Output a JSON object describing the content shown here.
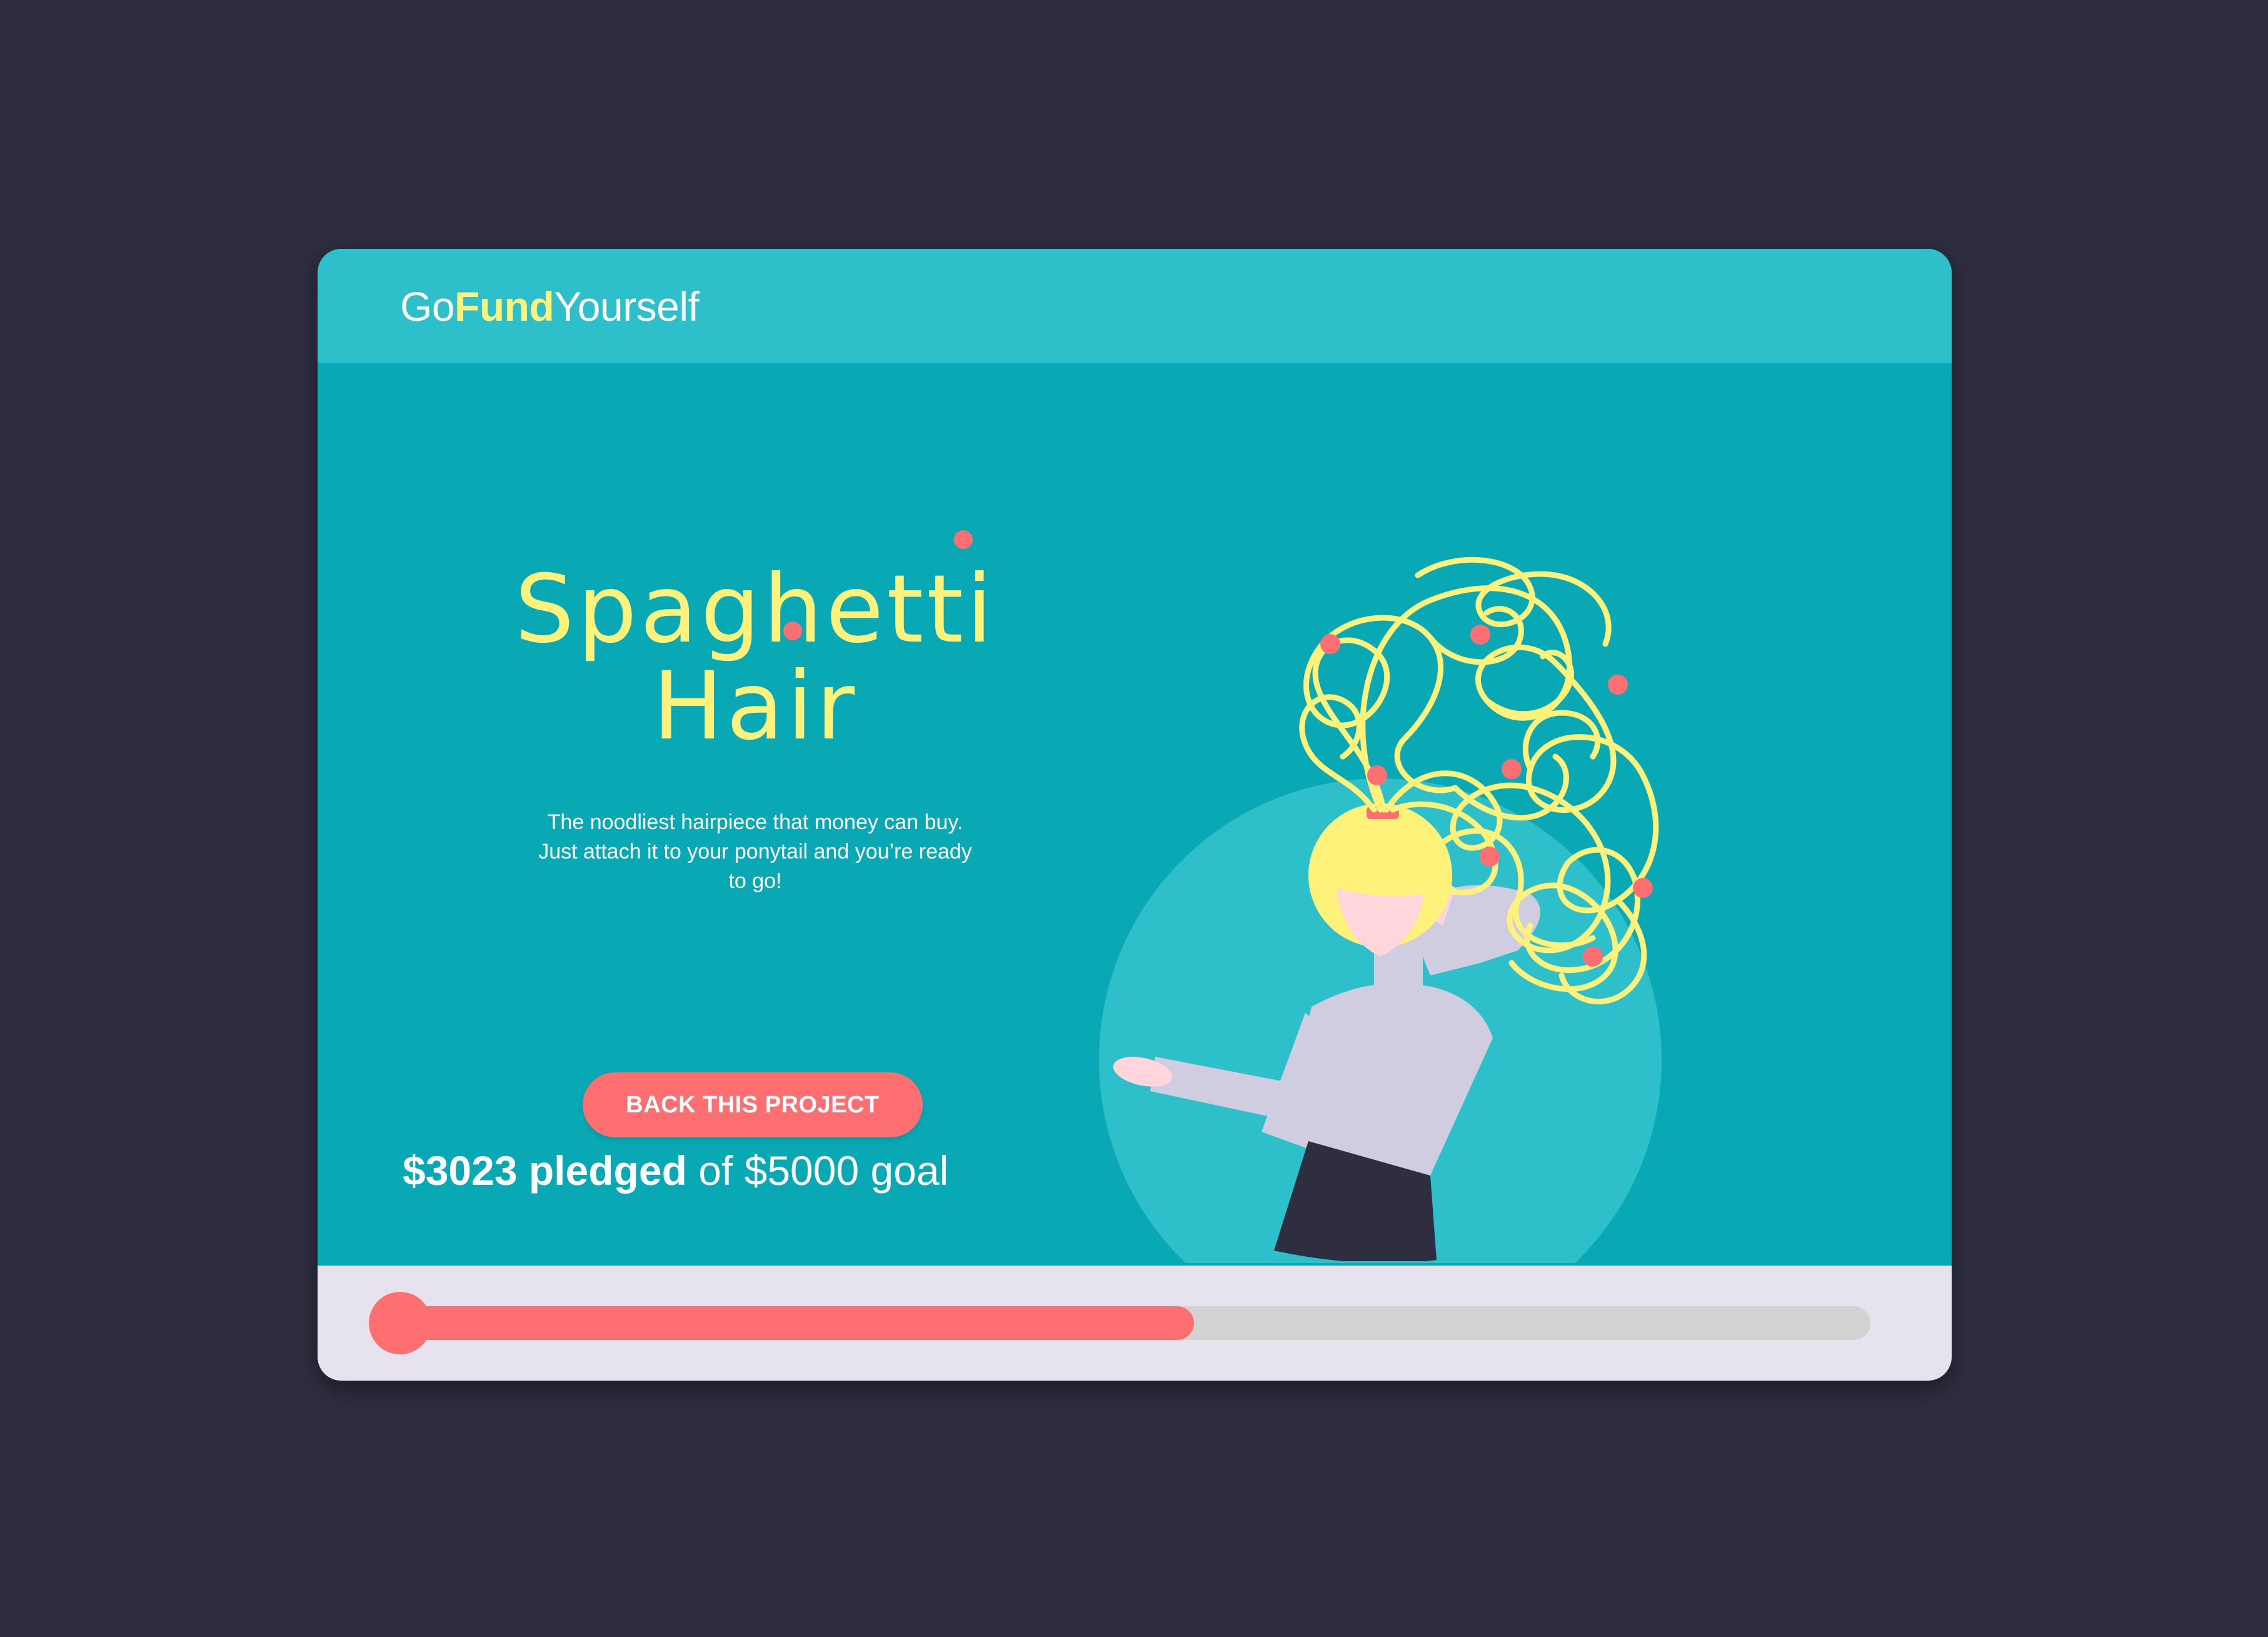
{
  "header": {
    "brand_prefix": "Go",
    "brand_accent": "Fund",
    "brand_suffix": "Yourself"
  },
  "hero": {
    "title_line1": "Spaghetti",
    "title_line2": "Hair",
    "description": "The noodliest hairpiece that money can buy. Just attach it to your ponytail and you’re ready to go!",
    "cta_label": "BACK THIS PROJECT",
    "illustration": "woman-with-spaghetti-hair-illustration"
  },
  "funding": {
    "pledged_text": "$3023 pledged",
    "goal_text": "of $5000 goal",
    "pledged": 3023,
    "goal": 5000,
    "progress_fraction": 0.54
  },
  "colors": {
    "background": "#2f2e41",
    "header_bar": "#2ec0ca",
    "hero": "#09a8b5",
    "accent_yellow": "#fff27a",
    "accent_coral": "#fe6f72",
    "progress_track": "#d2d2d2",
    "progress_panel": "#e6e3ef"
  }
}
